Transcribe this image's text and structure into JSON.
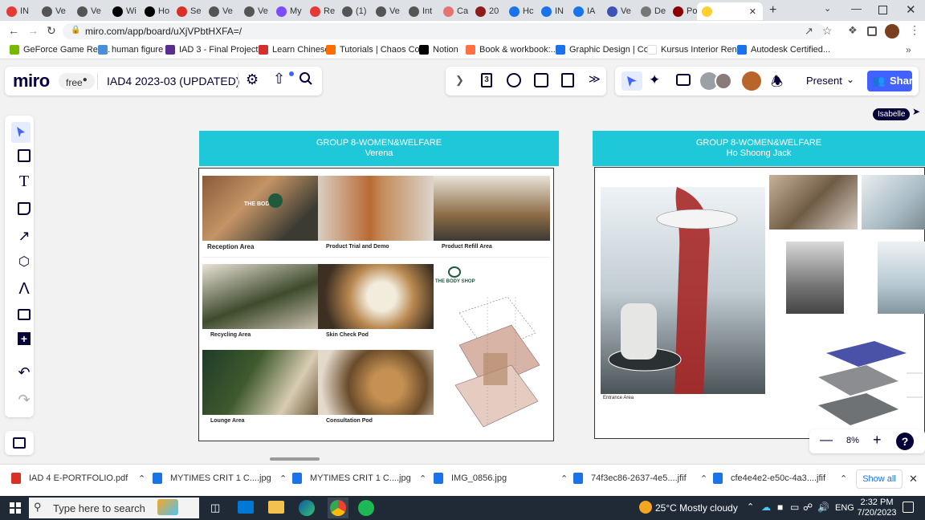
{
  "browser": {
    "tabs": [
      {
        "label": "IN",
        "color": "#e53935"
      },
      {
        "label": "Ve",
        "color": "#555"
      },
      {
        "label": "Ve",
        "color": "#555"
      },
      {
        "label": "Wi",
        "color": "#000"
      },
      {
        "label": "Ho",
        "color": "#000"
      },
      {
        "label": "Se",
        "color": "#d93025"
      },
      {
        "label": "Ve",
        "color": "#555"
      },
      {
        "label": "Ve",
        "color": "#555"
      },
      {
        "label": "My",
        "color": "#7c4dff"
      },
      {
        "label": "Re",
        "color": "#e53935"
      },
      {
        "label": "(1)",
        "color": "#555"
      },
      {
        "label": "Ve",
        "color": "#555"
      },
      {
        "label": "Int",
        "color": "#555"
      },
      {
        "label": "Ca",
        "color": "#e57373"
      },
      {
        "label": "20",
        "color": "#8e1c1c"
      },
      {
        "label": "Hc",
        "color": "#1a73e8"
      },
      {
        "label": "IN",
        "color": "#1a73e8"
      },
      {
        "label": "IA",
        "color": "#1a73e8"
      },
      {
        "label": "Ve",
        "color": "#3f51b5"
      },
      {
        "label": "De",
        "color": "#777"
      },
      {
        "label": "Po",
        "color": "#8b0000"
      },
      {
        "label": "",
        "color": "#ffd02f"
      }
    ],
    "url": "miro.com/app/board/uXjVPbtHXFA=/",
    "bookmarks": [
      {
        "label": "GeForce Game Rea...",
        "color": "#76b900"
      },
      {
        "label": "human figure",
        "color": "#4a90d9"
      },
      {
        "label": "IAD 3 - Final Project...",
        "color": "#5c2d91"
      },
      {
        "label": "Learn Chinese",
        "color": "#d32f2f"
      },
      {
        "label": "Tutorials | Chaos Co...",
        "color": "#ff6d00"
      },
      {
        "label": "Notion",
        "color": "#000"
      },
      {
        "label": "Book & workbook:...",
        "color": "#ff7043"
      },
      {
        "label": "Graphic Design | Co...",
        "color": "#1a73e8"
      },
      {
        "label": "Kursus Interior Ren...",
        "color": "#ffffff"
      },
      {
        "label": "Autodesk Certified...",
        "color": "#1a73e8"
      }
    ]
  },
  "miro": {
    "logo": "miro",
    "plan_badge": "free",
    "board_title": "IAD4 2023-03 (UPDATED)",
    "toolbar_count": "3",
    "present_label": "Present",
    "share_label": "Share",
    "cursor_name": "Isabelle",
    "zoom": "8%",
    "help": "?"
  },
  "frames": [
    {
      "title": "GROUP 8-WOMEN&WELFARE",
      "subtitle": "Verena",
      "captions": [
        "Reception Area",
        "Product Trial and Demo",
        "Product Refill Area",
        "Recycling Area",
        "Skin Check Pod",
        "Lounge Area",
        "Consultation Pod"
      ],
      "brand": "THE BODY SHOP",
      "sign_text": "THE BOD"
    },
    {
      "title": "GROUP 8-WOMEN&WELFARE",
      "subtitle": "Ho Shoong Jack",
      "captions": [
        "Entrance Area"
      ]
    }
  ],
  "downloads": {
    "items": [
      {
        "name": "IAD 4 E-PORTFOLIO.pdf",
        "color": "#d93025"
      },
      {
        "name": "MYTIMES CRIT 1 C....jpg",
        "color": "#1a73e8"
      },
      {
        "name": "MYTIMES CRIT 1 C....jpg",
        "color": "#1a73e8"
      },
      {
        "name": "IMG_0856.jpg",
        "color": "#1a73e8"
      },
      {
        "name": "74f3ec86-2637-4e5....jfif",
        "color": "#1a73e8"
      },
      {
        "name": "cfe4e4e2-e50c-4a3....jfif",
        "color": "#1a73e8"
      }
    ],
    "show_all": "Show all"
  },
  "taskbar": {
    "search_placeholder": "Type here to search",
    "weather": "25°C  Mostly cloudy",
    "language": "ENG",
    "time": "2:32 PM",
    "date": "7/20/2023"
  }
}
